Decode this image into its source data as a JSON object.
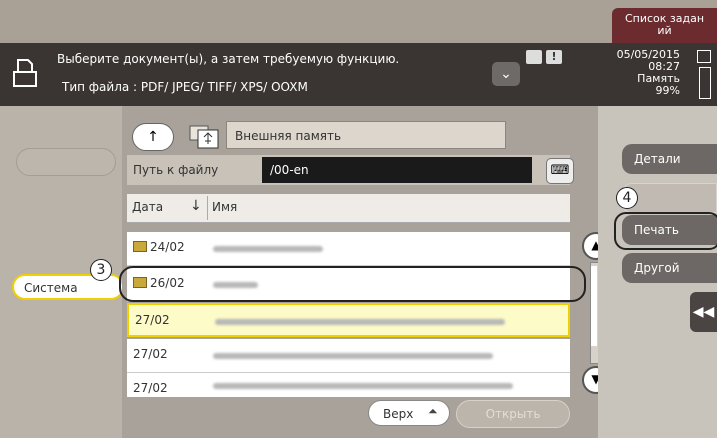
{
  "header": {
    "job_list_line1": "Список задан",
    "job_list_line2": "ий"
  },
  "message": {
    "line1": "Выберите документ(ы), а затем требуемую функцию.",
    "line2": "Тип файла        : PDF/ JPEG/ TIFF/ XPS/ OOXM"
  },
  "status": {
    "date": "05/05/2015",
    "time": "08:27",
    "memory_label": "Память",
    "memory_value": "99%",
    "warning_icon_glyph": "!"
  },
  "left": {
    "system_label": "Система"
  },
  "location": {
    "up_glyph": "↑",
    "storage_name": "Внешняя память",
    "path_label": "Путь к файлу",
    "path_value": "/00-en",
    "keyboard_glyph": "⌨"
  },
  "list": {
    "date_header": "Дата",
    "sort_glyph": "↓",
    "name_header": "Имя",
    "rows": [
      {
        "date": "24/02",
        "folder": true
      },
      {
        "date": "26/02",
        "folder": true
      },
      {
        "date": "27/02",
        "folder": false,
        "selected": true
      },
      {
        "date": "27/02",
        "folder": false
      },
      {
        "date": "27/02",
        "folder": false
      }
    ]
  },
  "bottom": {
    "top_label": "Верх",
    "top_glyph": "⏶",
    "open_label": "Открыть"
  },
  "right": {
    "detail_label": "Детали",
    "print_label": "Печать",
    "other_label": "Другой",
    "collapse_glyph": "◀◀"
  },
  "callouts": {
    "c3": "3",
    "c4": "4"
  },
  "colors": {
    "selected_border": "#f0d000",
    "job_list_bg": "#6b2b2f",
    "dark_bar": "#3a3532"
  }
}
